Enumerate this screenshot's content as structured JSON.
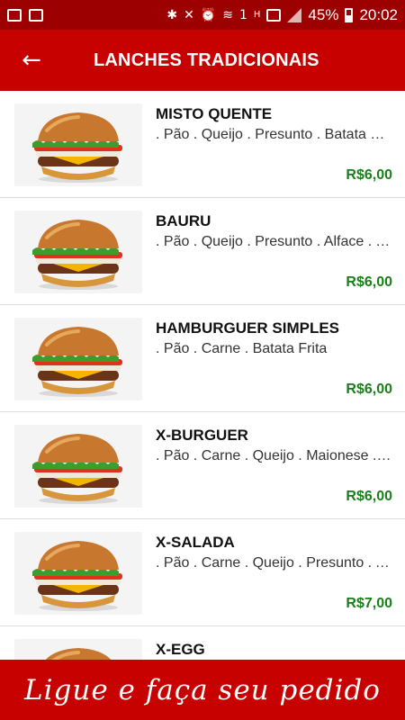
{
  "status_bar": {
    "battery": "45%",
    "time": "20:02",
    "notification_count": "1",
    "network_letter": "H"
  },
  "header": {
    "back_icon": "arrow-left-icon",
    "title": "LANCHES TRADICIONAIS"
  },
  "items": [
    {
      "name": "MISTO QUENTE",
      "desc": ". Pão . Queijo . Presunto . Batata Frita",
      "price": "R$6,00"
    },
    {
      "name": "BAURU",
      "desc": ". Pão . Queijo . Presunto . Alface . Tomate",
      "price": "R$6,00"
    },
    {
      "name": "HAMBURGUER SIMPLES",
      "desc": ". Pão . Carne . Batata Frita",
      "price": "R$6,00"
    },
    {
      "name": "X-BURGUER",
      "desc": ". Pão . Carne . Queijo . Maionese . Batata",
      "price": "R$6,00"
    },
    {
      "name": "X-SALADA",
      "desc": ". Pão . Carne . Queijo . Presunto . Alface",
      "price": "R$7,00"
    },
    {
      "name": "X-EGG",
      "desc": "",
      "price": ""
    }
  ],
  "banner": {
    "text": "Ligue e faça seu pedido"
  },
  "colors": {
    "primary": "#c70000",
    "status_bar": "#9d0000",
    "price": "#1a7f1a"
  }
}
